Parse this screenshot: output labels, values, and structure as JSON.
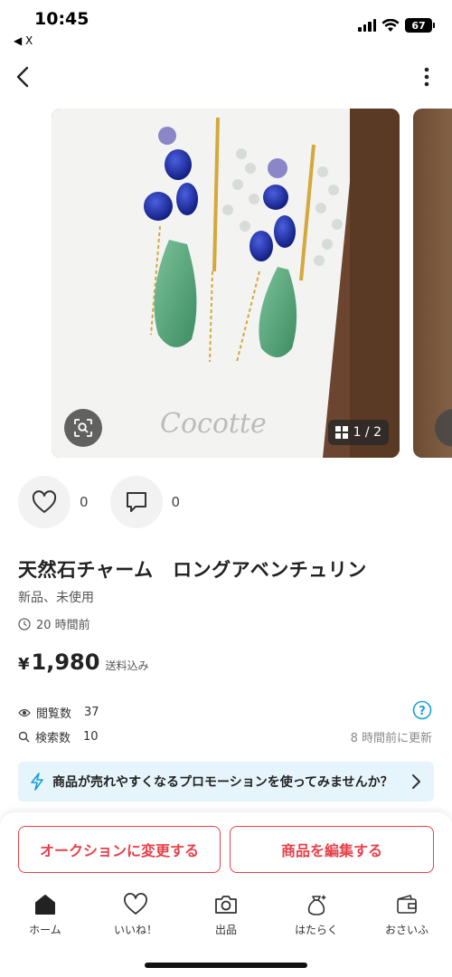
{
  "status_bar": {
    "time": "10:45",
    "back_app": "◀ X",
    "battery": "67"
  },
  "gallery": {
    "page_counter": "1 / 2",
    "card_brand": "Cocotte"
  },
  "reactions": {
    "like_count": "0",
    "comment_count": "0"
  },
  "product": {
    "title": "天然石チャーム　ロングアベンチュリン",
    "condition": "新品、未使用",
    "posted": "20 時間前",
    "price_currency": "¥",
    "price": "1,980",
    "shipping": "送料込み"
  },
  "stats": {
    "views_label": "閲覧数",
    "views": "37",
    "searches_label": "検索数",
    "searches": "10",
    "updated": "8 時間前に更新"
  },
  "promo": {
    "text": "商品が売れやすくなるプロモーションを使ってみませんか？"
  },
  "actions": {
    "auction_label": "オークションに変更する",
    "edit_label": "商品を編集する"
  },
  "tabs": [
    {
      "label": "ホーム",
      "icon": "home-icon"
    },
    {
      "label": "いいね！",
      "icon": "heart-icon"
    },
    {
      "label": "出品",
      "icon": "camera-icon"
    },
    {
      "label": "はたらく",
      "icon": "money-bag-icon"
    },
    {
      "label": "おさいふ",
      "icon": "wallet-icon"
    }
  ],
  "colors": {
    "accent": "#e8404a",
    "promo_bg": "#e6f4fb",
    "info": "#1a9fd6"
  }
}
